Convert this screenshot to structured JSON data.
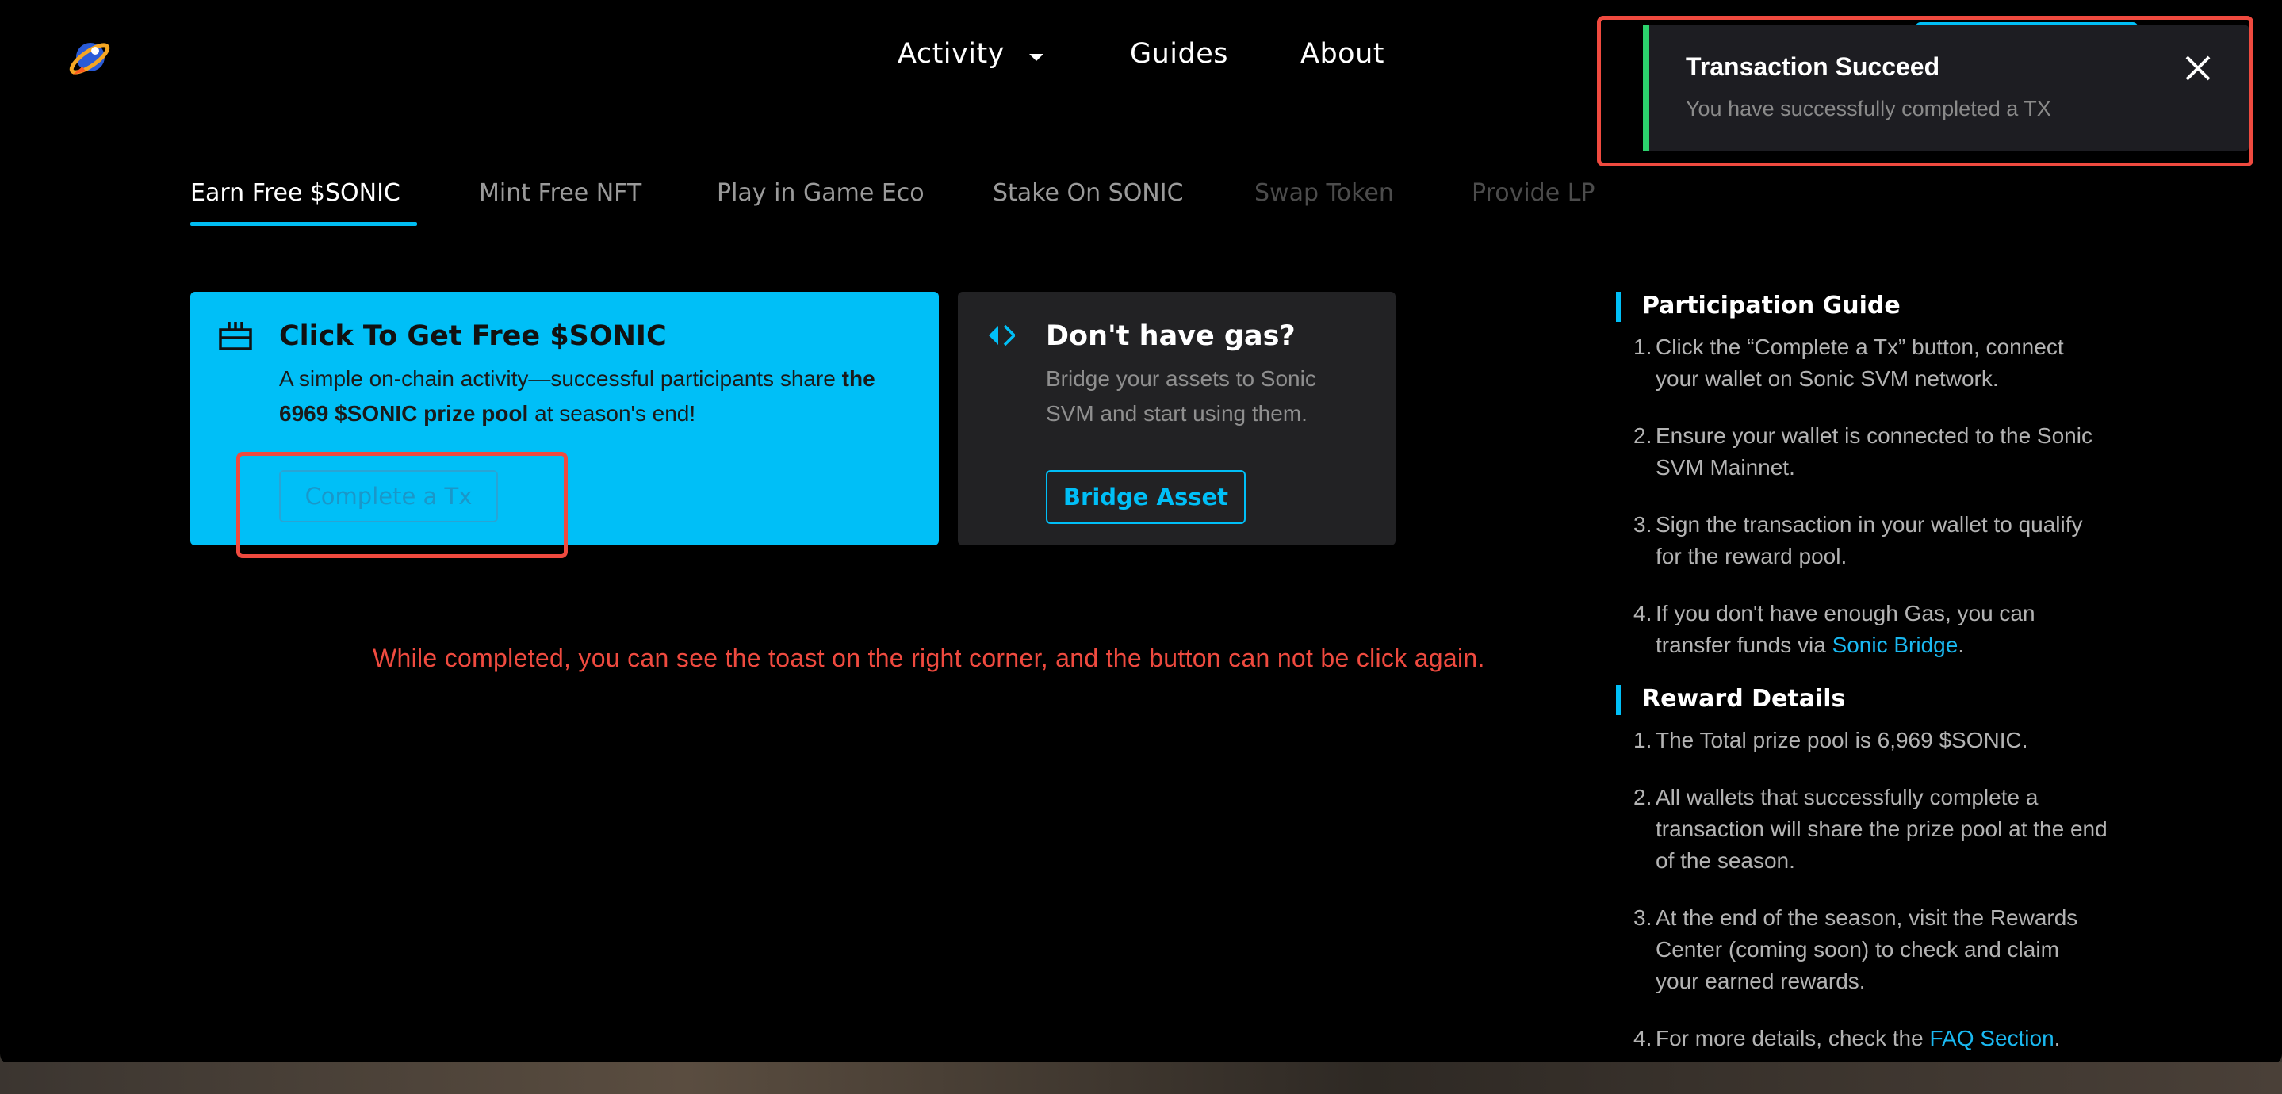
{
  "nav": {
    "items": [
      {
        "label": "Activity"
      },
      {
        "label": "Guides"
      },
      {
        "label": "About"
      }
    ]
  },
  "tabs": [
    {
      "label": "Earn Free $SONIC",
      "state": "active"
    },
    {
      "label": "Mint Free NFT",
      "state": "normal"
    },
    {
      "label": "Play in Game Eco",
      "state": "normal"
    },
    {
      "label": "Stake On SONIC",
      "state": "normal"
    },
    {
      "label": "Swap Token",
      "state": "disabled"
    },
    {
      "label": "Provide LP",
      "state": "disabled"
    }
  ],
  "earn_card": {
    "icon": "gift-icon",
    "title": "Click To Get Free $SONIC",
    "desc_before": "A simple on-chain activity—successful participants share ",
    "desc_bold": "the 6969 $SONIC prize pool",
    "desc_after": " at season's end!",
    "button_label": "Complete a Tx"
  },
  "gas_card": {
    "icon": "bridge-arrows-icon",
    "title": "Don't have gas?",
    "desc": "Bridge your assets to Sonic SVM and start using them.",
    "button_label": "Bridge Asset"
  },
  "annotation": {
    "text": "While completed, you can see the toast on the right corner, and the button can not be click again.",
    "color": "#ef4a3f"
  },
  "participation_guide": {
    "title": "Participation Guide",
    "items": [
      {
        "num": "1.",
        "text": "Click the “Complete a Tx” button, connect your wallet on Sonic SVM network."
      },
      {
        "num": "2.",
        "text": "Ensure your wallet is connected to the Sonic SVM Mainnet."
      },
      {
        "num": "3.",
        "text": "Sign the transaction in your wallet to qualify for the reward pool."
      },
      {
        "num": "4.",
        "text": "If you don't have enough Gas, you can transfer funds via ",
        "link": "Sonic Bridge",
        "after": "."
      }
    ]
  },
  "reward_details": {
    "title": "Reward Details",
    "items": [
      {
        "num": "1.",
        "text": "The Total prize pool is 6,969 $SONIC."
      },
      {
        "num": "2.",
        "text": "All wallets that successfully complete a transaction will share the prize pool at the end of the season."
      },
      {
        "num": "3.",
        "text": "At the end of the season, visit the Rewards Center (coming soon) to check and claim your earned rewards."
      },
      {
        "num": "4.",
        "text": "For more details, check the ",
        "link": "FAQ Section",
        "after": "."
      }
    ]
  },
  "toast": {
    "title": "Transaction Succeed",
    "message": "You have successfully completed a TX",
    "status_color": "#2cd26d"
  },
  "colors": {
    "accent": "#00bff7",
    "background": "#000000"
  }
}
